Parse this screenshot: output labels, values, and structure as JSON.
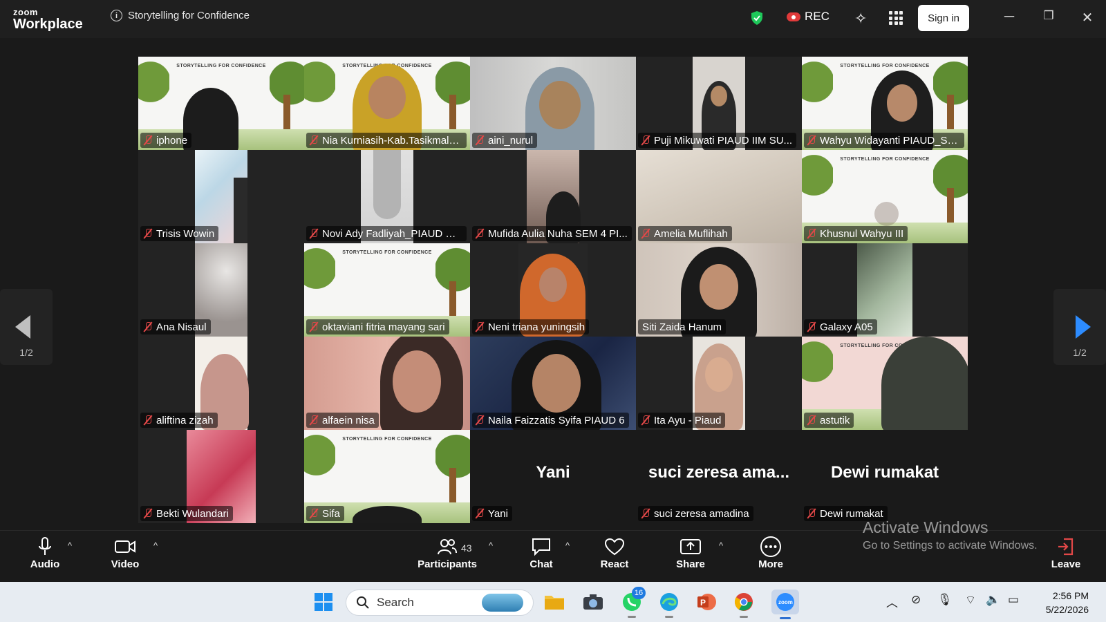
{
  "app": {
    "logo_top": "zoom",
    "logo_bottom": "Workplace",
    "meeting_title": "Storytelling for Confidence"
  },
  "header": {
    "rec_label": "REC",
    "signin_label": "Sign in"
  },
  "nav": {
    "page_left": "1/2",
    "page_right": "1/2"
  },
  "banner_text": "STORYTELLING FOR CONFIDENCE",
  "tiles": [
    {
      "name": "iphone"
    },
    {
      "name": "Nia Kurniasih-Kab.Tasikmalaya"
    },
    {
      "name": "aini_nurul"
    },
    {
      "name": "Puji Mikuwati PIAUD IIM SU..."
    },
    {
      "name": "Wahyu Widayanti PIAUD_SE..."
    },
    {
      "name": "Trisis Wowin"
    },
    {
      "name": "Novi Ady Fadliyah_PIAUD SE..."
    },
    {
      "name": "Mufida Aulia Nuha SEM 4 PI..."
    },
    {
      "name": "Amelia Muflihah"
    },
    {
      "name": "Khusnul Wahyu III"
    },
    {
      "name": "Ana Nisaul"
    },
    {
      "name": "oktaviani fitria mayang sari"
    },
    {
      "name": "Neni triana yuningsih"
    },
    {
      "name": "Siti Zaida Hanum"
    },
    {
      "name": "Galaxy A05"
    },
    {
      "name": "aliftina zizah"
    },
    {
      "name": "alfaein nisa"
    },
    {
      "name": "Naila Faizzatis Syifa PIAUD 6"
    },
    {
      "name": "Ita Ayu - Piaud"
    },
    {
      "name": "astutik"
    },
    {
      "name": "Bekti Wulandari"
    },
    {
      "name": "Sifa"
    },
    {
      "name": "Yani",
      "big": "Yani"
    },
    {
      "name": "suci zeresa amadina",
      "big": "suci zeresa ama..."
    },
    {
      "name": "Dewi rumakat",
      "big": "Dewi rumakat"
    }
  ],
  "toolbar": {
    "audio": "Audio",
    "video": "Video",
    "participants": "Participants",
    "participants_count": "43",
    "chat": "Chat",
    "react": "React",
    "share": "Share",
    "more": "More",
    "leave": "Leave"
  },
  "watermark": {
    "line1": "Activate Windows",
    "line2": "Go to Settings to activate Windows."
  },
  "taskbar": {
    "search_placeholder": "Search",
    "whatsapp_badge": "16",
    "time": "2:56 PM",
    "date": "5/22/2026"
  },
  "colors": {
    "active_speaker": "#2dd48f",
    "mute": "#e34848",
    "nav_arrow": "#2d8cff"
  }
}
